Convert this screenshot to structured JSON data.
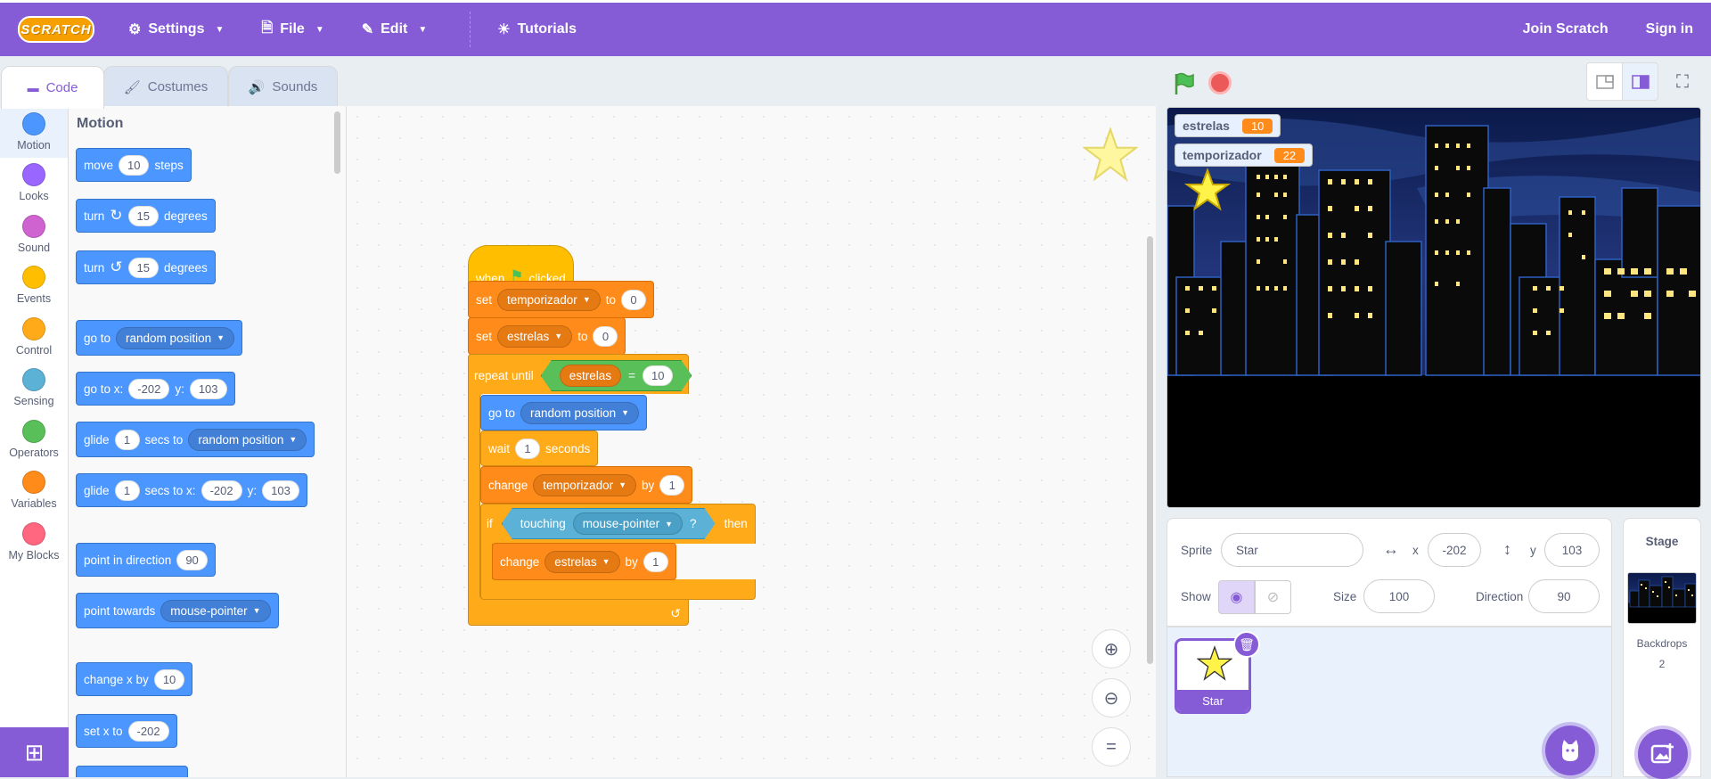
{
  "menubar": {
    "logo": "SCRATCH",
    "settings": "Settings",
    "file": "File",
    "edit": "Edit",
    "tutorials": "Tutorials",
    "join": "Join Scratch",
    "signin": "Sign in"
  },
  "tabs": {
    "code": "Code",
    "costumes": "Costumes",
    "sounds": "Sounds"
  },
  "categories": [
    {
      "label": "Motion",
      "color": "#4c97ff"
    },
    {
      "label": "Looks",
      "color": "#9966ff"
    },
    {
      "label": "Sound",
      "color": "#cf63cf"
    },
    {
      "label": "Events",
      "color": "#ffbf00"
    },
    {
      "label": "Control",
      "color": "#ffab19"
    },
    {
      "label": "Sensing",
      "color": "#5cb1d6"
    },
    {
      "label": "Operators",
      "color": "#59c059"
    },
    {
      "label": "Variables",
      "color": "#ff8c1a"
    },
    {
      "label": "My Blocks",
      "color": "#ff6680"
    }
  ],
  "palette": {
    "title": "Motion",
    "move": {
      "a": "move",
      "n": "10",
      "b": "steps"
    },
    "turn_cw": {
      "a": "turn",
      "n": "15",
      "b": "degrees"
    },
    "turn_ccw": {
      "a": "turn",
      "n": "15",
      "b": "degrees"
    },
    "goto": {
      "a": "go to",
      "dd": "random position"
    },
    "gotoxy": {
      "a": "go to x:",
      "x": "-202",
      "b": "y:",
      "y": "103"
    },
    "glide": {
      "a": "glide",
      "n": "1",
      "b": "secs to",
      "dd": "random position"
    },
    "glidexy": {
      "a": "glide",
      "n": "1",
      "b": "secs to x:",
      "x": "-202",
      "c": "y:",
      "y": "103"
    },
    "point_dir": {
      "a": "point in direction",
      "n": "90"
    },
    "point_towards": {
      "a": "point towards",
      "dd": "mouse-pointer"
    },
    "change_x": {
      "a": "change x by",
      "n": "10"
    },
    "set_x": {
      "a": "set x to",
      "n": "-202"
    }
  },
  "script": {
    "hat": {
      "a": "when",
      "b": "clicked"
    },
    "set1": {
      "a": "set",
      "var": "temporizador",
      "b": "to",
      "n": "0"
    },
    "set2": {
      "a": "set",
      "var": "estrelas",
      "b": "to",
      "n": "0"
    },
    "repeat": {
      "a": "repeat until",
      "var": "estrelas",
      "op": "=",
      "n": "10"
    },
    "goto": {
      "a": "go to",
      "dd": "random position"
    },
    "wait": {
      "a": "wait",
      "n": "1",
      "b": "seconds"
    },
    "change1": {
      "a": "change",
      "var": "temporizador",
      "b": "by",
      "n": "1"
    },
    "if": {
      "a": "if",
      "touch": "touching",
      "dd": "mouse-pointer",
      "q": "?",
      "then": "then"
    },
    "change2": {
      "a": "change",
      "var": "estrelas",
      "b": "by",
      "n": "1"
    }
  },
  "monitors": [
    {
      "name": "estrelas",
      "value": "10"
    },
    {
      "name": "temporizador",
      "value": "22"
    }
  ],
  "sprite_info": {
    "sprite_label": "Sprite",
    "sprite_name": "Star",
    "x_label": "x",
    "x": "-202",
    "y_label": "y",
    "y": "103",
    "show_label": "Show",
    "size_label": "Size",
    "size": "100",
    "direction_label": "Direction",
    "direction": "90"
  },
  "sprite_list": [
    {
      "name": "Star"
    }
  ],
  "stage_panel": {
    "title": "Stage",
    "backdrops_label": "Backdrops",
    "backdrops_count": "2"
  },
  "colors": {
    "accent": "#855cd6",
    "motion": "#4c97ff",
    "variables": "#ff8c1a",
    "control": "#ffab19",
    "events": "#ffbf00"
  }
}
